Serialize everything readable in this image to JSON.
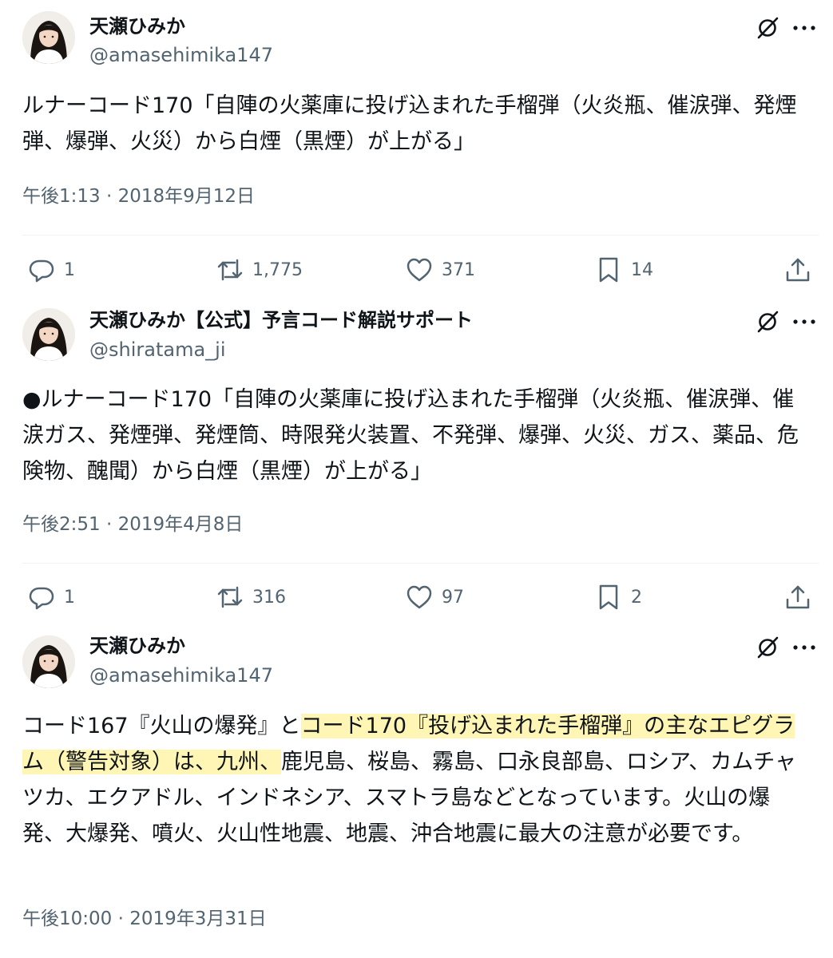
{
  "tweets": [
    {
      "display_name": "天瀬ひみか",
      "handle": "@amasehimika147",
      "text": "ルナーコード170「自陣の火薬庫に投げ込まれた手榴弾（火炎瓶、催涙弾、発煙弾、爆弾、火災）から白煙（黒煙）が上がる」",
      "timestamp": "午後1:13 · 2018年9月12日",
      "replies": "1",
      "retweets": "1,775",
      "likes": "371",
      "bookmarks": "14"
    },
    {
      "display_name": "天瀬ひみか【公式】予言コード解説サポート",
      "handle": "@shiratama_ji",
      "text": "●ルナーコード170「自陣の火薬庫に投げ込まれた手榴弾（火炎瓶、催涙弾、催涙ガス、発煙弾、発煙筒、時限発火装置、不発弾、爆弾、火災、ガス、薬品、危険物、醜聞）から白煙（黒煙）が上がる」",
      "timestamp": "午後2:51 · 2019年4月8日",
      "replies": "1",
      "retweets": "316",
      "likes": "97",
      "bookmarks": "2"
    },
    {
      "display_name": "天瀬ひみか",
      "handle": "@amasehimika147",
      "text_before": "コード167『火山の爆発』と",
      "text_highlight": "コード170『投げ込まれた手榴弾』の主なエピグラム（警告対象）は、九州、",
      "text_after": "鹿児島、桜島、霧島、口永良部島、ロシア、カムチャツカ、エクアドル、インドネシア、スマトラ島などとなっています。火山の爆発、大爆発、噴火、火山性地震、地震、沖合地震に最大の注意が必要です。",
      "timestamp": "午後10:00 · 2019年3月31日"
    }
  ],
  "icons": {
    "reply": "reply-icon",
    "retweet": "retweet-icon",
    "like": "like-icon",
    "bookmark": "bookmark-icon",
    "share": "share-icon",
    "grok": "grok-icon",
    "more": "more-icon"
  },
  "colors": {
    "text_primary": "#0f1419",
    "text_secondary": "#536471",
    "divider": "#eff3f4",
    "highlight": "#fff5b4"
  }
}
